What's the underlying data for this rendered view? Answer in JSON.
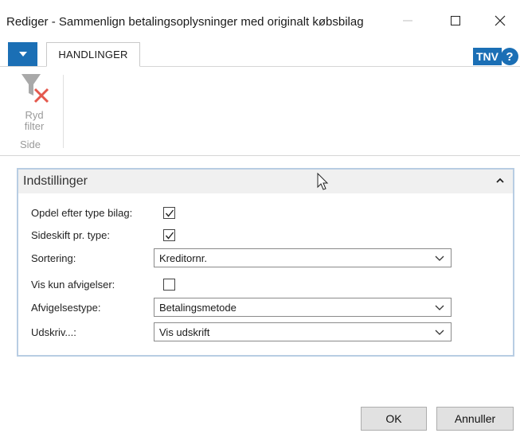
{
  "window": {
    "title": "Rediger - Sammenlign betalingsoplysninger med originalt købsbilag"
  },
  "ribbon": {
    "tab_label": "HANDLINGER",
    "badge": "TNV",
    "help_symbol": "?",
    "clear_filter_line1": "Ryd",
    "clear_filter_line2": "filter",
    "group_label": "Side"
  },
  "panel": {
    "title": "Indstillinger",
    "fields": {
      "split_by_type": {
        "label": "Opdel efter type bilag:",
        "checked": true
      },
      "page_break": {
        "label": "Sideskift pr. type:",
        "checked": true
      },
      "sorting": {
        "label": "Sortering:",
        "value": "Kreditornr."
      },
      "only_deviations": {
        "label": "Vis kun afvigelser:",
        "checked": false
      },
      "deviation_type": {
        "label": "Afvigelsestype:",
        "value": "Betalingsmetode"
      },
      "print": {
        "label": "Udskriv...:",
        "value": "Vis udskrift"
      }
    }
  },
  "buttons": {
    "ok": "OK",
    "cancel": "Annuller"
  },
  "colors": {
    "accent": "#1b6fb5",
    "panel_border": "#b8cde3",
    "panel_header_bg": "#f0f0f0"
  },
  "icons": [
    "minimize-icon",
    "maximize-icon",
    "close-icon",
    "dropdown-arrow-icon",
    "help-icon",
    "clear-filter-icon",
    "collapse-icon",
    "checkmark-icon",
    "chevron-down-icon",
    "mouse-cursor-icon"
  ]
}
